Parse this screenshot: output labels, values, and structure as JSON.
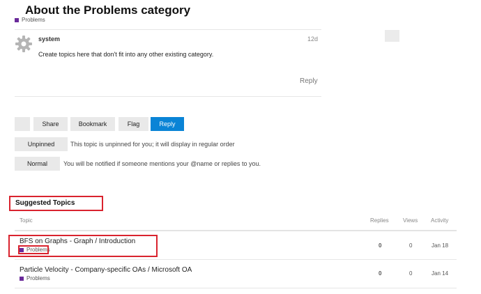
{
  "topic": {
    "title": "About the Problems category",
    "category": "Problems"
  },
  "post": {
    "author": "system",
    "date": "12d",
    "body": "Create topics here that don't fit into any other existing category.",
    "reply_label": "Reply"
  },
  "actions": {
    "share": "Share",
    "bookmark": "Bookmark",
    "flag": "Flag",
    "reply": "Reply"
  },
  "pin": {
    "button": "Unpinned",
    "note": "This topic is unpinned for you; it will display in regular order"
  },
  "notify": {
    "button": "Normal",
    "note": "You will be notified if someone mentions your @name or replies to you."
  },
  "suggested": {
    "heading": "Suggested Topics",
    "columns": {
      "topic": "Topic",
      "replies": "Replies",
      "views": "Views",
      "activity": "Activity"
    },
    "rows": [
      {
        "title": "BFS on Graphs - Graph / Introduction",
        "category": "Problems",
        "replies": "0",
        "views": "0",
        "activity": "Jan 18"
      },
      {
        "title": "Particle Velocity - Company-specific OAs / Microsoft OA",
        "category": "Problems",
        "replies": "0",
        "views": "0",
        "activity": "Jan 14"
      }
    ]
  },
  "colors": {
    "category": "#6a2a9a",
    "primary_button": "#0a84d6",
    "highlight": "#d9232e"
  },
  "icons": {
    "avatar": "gear-icon"
  }
}
